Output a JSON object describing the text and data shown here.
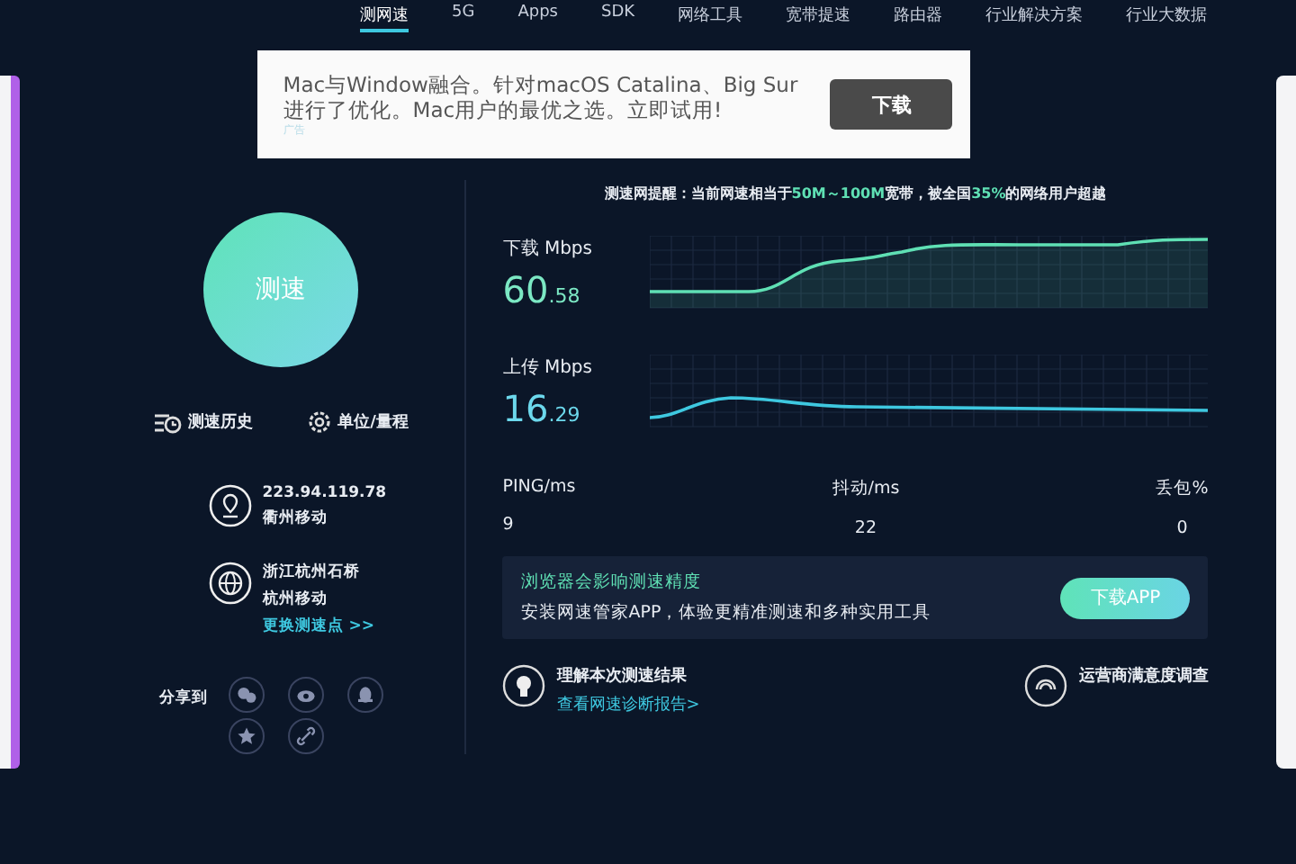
{
  "nav": {
    "items": [
      {
        "label": "测网速",
        "selected": true
      },
      {
        "label": "5G",
        "selected": false
      },
      {
        "label": "Apps",
        "selected": false
      },
      {
        "label": "SDK",
        "selected": false
      },
      {
        "label": "网络工具",
        "selected": false
      },
      {
        "label": "宽带提速",
        "selected": false
      },
      {
        "label": "路由器",
        "selected": false
      },
      {
        "label": "行业解决方案",
        "selected": false
      },
      {
        "label": "行业大数据",
        "selected": false
      }
    ]
  },
  "ad": {
    "text": "Mac与Window融合。针对macOS Catalina、Big Sur进行了优化。Mac用户的最优之选。立即试用!",
    "tag": "广告",
    "button": "下载"
  },
  "speed_test": {
    "button": "测速",
    "history": "测速历史",
    "settings": "单位/量程",
    "ip": "223.94.119.78",
    "isp": "衢州移动",
    "server_location": "浙江杭州石桥",
    "server_isp": "杭州移动",
    "change_server": "更换测速点 >>",
    "share_label": "分享到"
  },
  "notice": [
    {
      "text": "测速网提醒：当前网速相当于",
      "highlight": false
    },
    {
      "text": "50M～100M",
      "highlight": true
    },
    {
      "text": "宽带，被全国",
      "highlight": false
    },
    {
      "text": "35%",
      "highlight": true
    },
    {
      "text": "的网络用户超越",
      "highlight": false
    }
  ],
  "meters": [
    {
      "kind": "download",
      "label": "下载",
      "unit": "Mbps",
      "integer": "60",
      "decimal": ".58"
    },
    {
      "kind": "upload",
      "label": "上传",
      "unit": "Mbps",
      "integer": "16",
      "decimal": ".29"
    }
  ],
  "stats": [
    {
      "label": "PING/ms",
      "value": "9"
    },
    {
      "label": "抖动/ms",
      "value": "22"
    },
    {
      "label": "丢包%",
      "value": "0"
    }
  ],
  "promo": {
    "title": "浏览器会影响测速精度",
    "text": "安装网速管家APP，体验更精准测速和多种实用工具",
    "button": "下载APP"
  },
  "links": [
    {
      "kind": "report",
      "title": "理解本次测速结果",
      "link": "查看网速诊断报告>"
    },
    {
      "kind": "survey",
      "title": "运营商满意度调查"
    }
  ]
}
